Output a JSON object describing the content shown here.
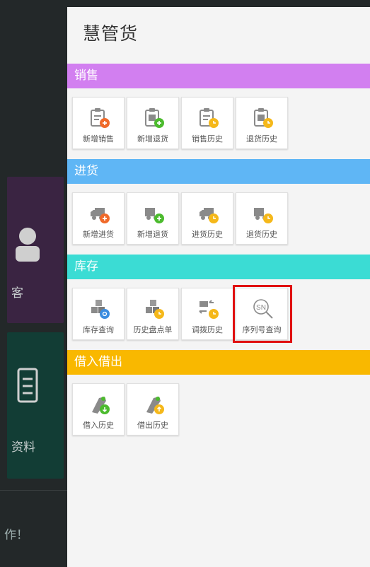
{
  "drawer": {
    "title": "慧管货"
  },
  "sections": [
    {
      "label": "销售",
      "color": "#d27ff0",
      "tiles": [
        {
          "label": "新增销售",
          "icon": "clipboard-add-icon",
          "badge": "#f06a2a"
        },
        {
          "label": "新增退货",
          "icon": "clipboard-return-add-icon",
          "badge": "#4cbb2e"
        },
        {
          "label": "销售历史",
          "icon": "clipboard-history-icon",
          "badge": "#f5b81a"
        },
        {
          "label": "退货历史",
          "icon": "clipboard-return-history-icon",
          "badge": "#f5b81a"
        }
      ]
    },
    {
      "label": "进货",
      "color": "#5fb6f5",
      "tiles": [
        {
          "label": "新增进货",
          "icon": "truck-add-icon",
          "badge": "#f06a2a"
        },
        {
          "label": "新增退货",
          "icon": "truck-return-add-icon",
          "badge": "#4cbb2e"
        },
        {
          "label": "进货历史",
          "icon": "truck-history-icon",
          "badge": "#f5b81a"
        },
        {
          "label": "退货历史",
          "icon": "truck-return-history-icon",
          "badge": "#f5b81a"
        }
      ]
    },
    {
      "label": "库存",
      "color": "#3bdcd4",
      "tiles": [
        {
          "label": "库存查询",
          "icon": "boxes-search-icon",
          "badge": "#3b8de0"
        },
        {
          "label": "历史盘点单",
          "icon": "boxes-history-icon",
          "badge": "#f5b81a"
        },
        {
          "label": "调拨历史",
          "icon": "transfer-history-icon",
          "badge": "#f5b81a"
        },
        {
          "label": "序列号查询",
          "icon": "serial-number-search-icon",
          "badge": ""
        }
      ]
    },
    {
      "label": "借入借出",
      "color": "#f9b800",
      "tiles": [
        {
          "label": "借入历史",
          "icon": "borrow-in-icon",
          "badge": "#4cbb2e"
        },
        {
          "label": "借出历史",
          "icon": "lend-out-icon",
          "badge": "#f5b81a"
        }
      ]
    }
  ],
  "background": {
    "card1_text": "客",
    "card2_text": "资料",
    "footer_text": "作！"
  }
}
